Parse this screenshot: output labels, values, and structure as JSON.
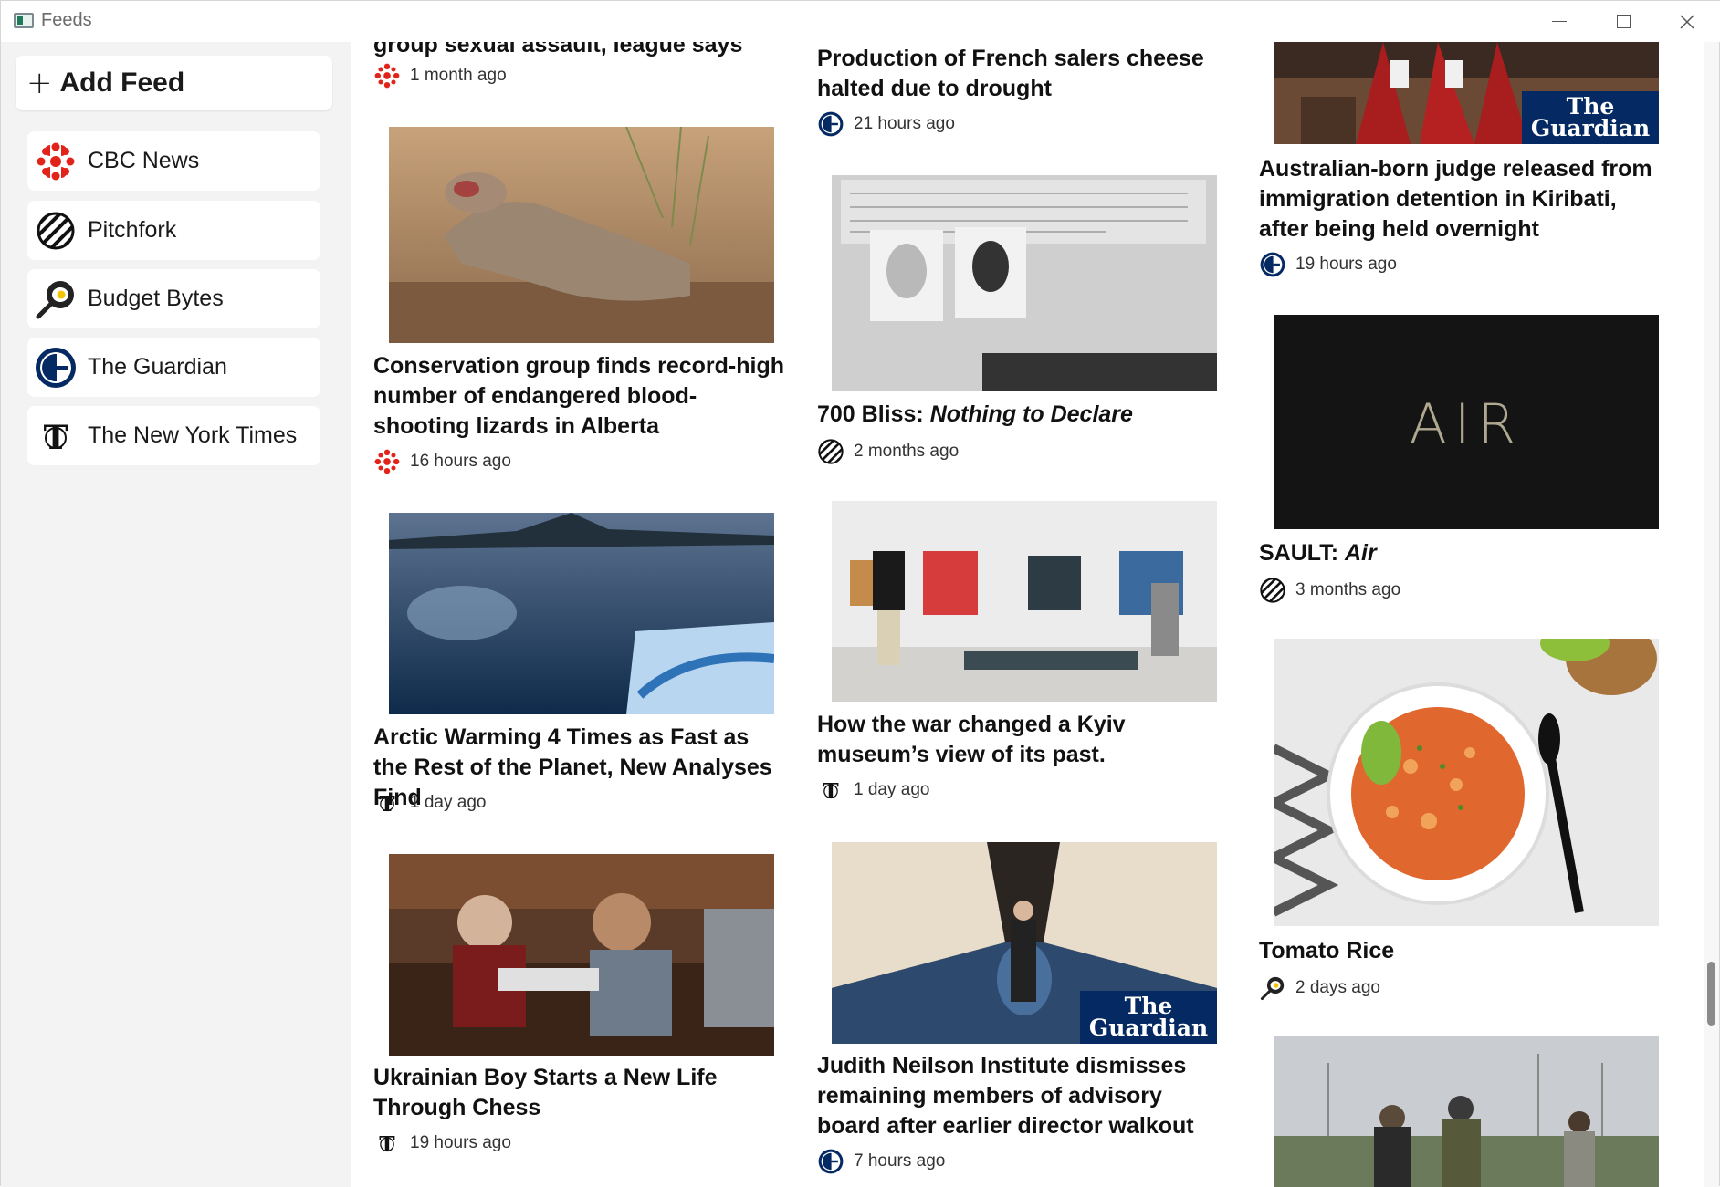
{
  "window": {
    "title": "Feeds"
  },
  "sidebar": {
    "add_feed_label": "Add Feed",
    "feeds": [
      {
        "label": "CBC News",
        "icon": "cbc-logo-icon"
      },
      {
        "label": "Pitchfork",
        "icon": "pitchfork-logo-icon"
      },
      {
        "label": "Budget Bytes",
        "icon": "budget-bytes-logo-icon"
      },
      {
        "label": "The Guardian",
        "icon": "guardian-logo-icon"
      },
      {
        "label": "The New York Times",
        "icon": "nyt-logo-icon"
      }
    ]
  },
  "columns": [
    {
      "cards": [
        {
          "headline": "group sexual assault, league says",
          "source": "CBC News",
          "time": "1 month ago"
        },
        {
          "headline": "Conservation group finds record-high number of endangered blood-shooting lizards in Alberta",
          "source": "CBC News",
          "time": "16 hours ago",
          "image": "horned lizard on rocks"
        },
        {
          "headline": "Arctic Warming 4 Times as Fast as the Rest of the Planet, New Analyses Find",
          "source": "The New York Times",
          "time": "1 day ago",
          "image": "arctic water and ice"
        },
        {
          "headline": "Ukrainian Boy Starts a New Life Through Chess",
          "source": "The New York Times",
          "time": "19 hours ago",
          "image": "boy playing chess"
        }
      ]
    },
    {
      "cards": [
        {
          "headline": "Production of French salers cheese halted due to drought",
          "source": "The Guardian",
          "time": "21 hours ago"
        },
        {
          "headline_prefix": "700 Bliss: ",
          "headline_italic": "Nothing to Declare",
          "source": "Pitchfork",
          "time": "2 months ago",
          "image": "passport photos on document"
        },
        {
          "headline": "How the war changed a Kyiv museum’s view of its past.",
          "source": "The New York Times",
          "time": "1 day ago",
          "image": "museum gallery visitors"
        },
        {
          "headline": "Judith Neilson Institute dismisses remaining members of advisory board after earlier director walkout",
          "source": "The Guardian",
          "time": "7 hours ago",
          "image": "art installation hall",
          "badge": "The Guardian"
        }
      ]
    },
    {
      "cards": [
        {
          "headline": "Australian-born judge released from immigration detention in Kiribati, after being held overnight",
          "source": "The Guardian",
          "time": "19 hours ago",
          "image": "judges in red robes",
          "badge": "The Guardian"
        },
        {
          "headline_prefix": "SAULT: ",
          "headline_italic": "Air",
          "source": "Pitchfork",
          "time": "3 months ago",
          "image": "album cover",
          "image_text": "AIR"
        },
        {
          "headline": "Tomato Rice",
          "source": "Budget Bytes",
          "time": "2 days ago",
          "image": "plate of tomato rice"
        },
        {
          "image": "people walking in park"
        }
      ]
    }
  ]
}
